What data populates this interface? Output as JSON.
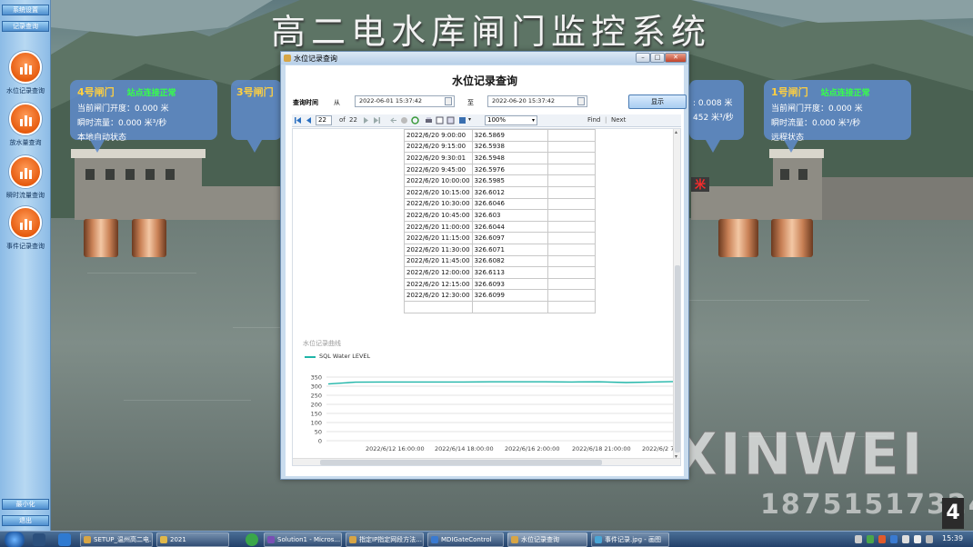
{
  "app_title": "高二电水库闸门监控系统",
  "sidebar": {
    "top_buttons": [
      "系统设置",
      "记录查询"
    ],
    "items": [
      {
        "label": "水位记录查询",
        "icon": "bar-chart-icon"
      },
      {
        "label": "放水量查询",
        "icon": "bar-chart-icon"
      },
      {
        "label": "瞬时流量查询",
        "icon": "bar-chart-icon"
      },
      {
        "label": "事件记录查询",
        "icon": "bar-chart-icon"
      }
    ],
    "bottom_buttons": [
      "最小化",
      "退出"
    ]
  },
  "gates": {
    "gate4": {
      "name": "4号闸门",
      "status": "站点连接正常",
      "opening": "当前闸门开度：0.000 米",
      "flow": "瞬时流量：0.000 米³/秒",
      "mode": "本地自动状态"
    },
    "gate3": {
      "name": "3号闸门"
    },
    "gate2": {
      "opening_partial": ": 0.008 米",
      "flow_partial": "452 米³/秒"
    },
    "gate1": {
      "name": "1号闸门",
      "status": "站点连接正常",
      "opening": "当前闸门开度：0.000 米",
      "flow": "瞬时流量：0.000 米³/秒",
      "mode": "远程状态"
    },
    "meter_fragment": "米"
  },
  "dialog": {
    "window_title": "水位记录查询",
    "heading": "水位记录查询",
    "query_time_label": "查询时间",
    "from_label": "从",
    "from_value": "2022-06-01 15:37:42",
    "to_label": "至",
    "to_value": "2022-06-20 15:37:42",
    "show_button": "显示",
    "toolbar": {
      "page": "22",
      "of_label": "of",
      "total_pages": "22",
      "zoom": "100%",
      "find": "Find",
      "next": "Next"
    },
    "table_rows": [
      [
        "2022/6/20 9:00:00",
        "326.5869"
      ],
      [
        "2022/6/20 9:15:00",
        "326.5938"
      ],
      [
        "2022/6/20 9:30:01",
        "326.5948"
      ],
      [
        "2022/6/20 9:45:00",
        "326.5976"
      ],
      [
        "2022/6/20 10:00:00",
        "326.5985"
      ],
      [
        "2022/6/20 10:15:00",
        "326.6012"
      ],
      [
        "2022/6/20 10:30:00",
        "326.6046"
      ],
      [
        "2022/6/20 10:45:00",
        "326.603"
      ],
      [
        "2022/6/20 11:00:00",
        "326.6044"
      ],
      [
        "2022/6/20 11:15:00",
        "326.6097"
      ],
      [
        "2022/6/20 11:30:00",
        "326.6071"
      ],
      [
        "2022/6/20 11:45:00",
        "326.6082"
      ],
      [
        "2022/6/20 12:00:00",
        "326.6113"
      ],
      [
        "2022/6/20 12:15:00",
        "326.6093"
      ],
      [
        "2022/6/20 12:30:00",
        "326.6099"
      ]
    ],
    "chart_title": "水位记录曲线",
    "legend": "SQL Water LEVEL",
    "line_color": "#1fb5a8"
  },
  "chart_data": {
    "type": "line",
    "title": "水位记录曲线",
    "series": [
      {
        "name": "SQL Water LEVEL",
        "values": [
          312,
          322,
          323,
          323,
          323,
          323,
          324,
          324,
          324,
          323,
          324,
          320,
          323,
          326
        ]
      }
    ],
    "y_ticks": [
      "350",
      "300",
      "250",
      "200",
      "150",
      "100",
      "50",
      "0"
    ],
    "ylim": [
      0,
      350
    ],
    "x_ticks": [
      "2022/6/12 16:00:00",
      "2022/6/14 18:00:00",
      "2022/6/16 2:00:00",
      "2022/6/18 21:00:00",
      "2022/6/2 7:4"
    ],
    "grid": true,
    "legend_position": "top-left"
  },
  "watermark": {
    "line1": "XINWEI",
    "line2": "18751517324"
  },
  "taskbar": {
    "tasks": [
      "SETUP_温州高二电...",
      "2021",
      "Solution1 - Micros...",
      "指定IP指定网段方法...",
      "MDIGateControl",
      "水位记录查询",
      "事件记录.jpg - 画图"
    ],
    "active_task": 5,
    "clock": "15:39"
  }
}
